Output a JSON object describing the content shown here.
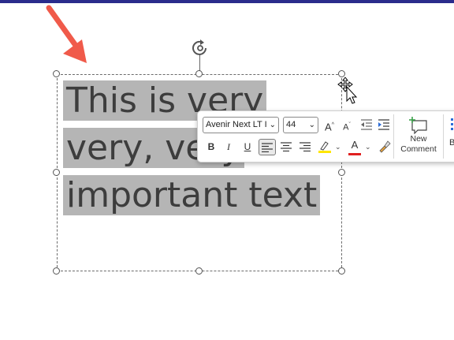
{
  "slide": {
    "text_lines": [
      "This is very",
      "very, very",
      "important text"
    ]
  },
  "mini_toolbar": {
    "font_name": "Avenir Next LT I",
    "font_size": "44",
    "grow_font": "A",
    "shrink_font": "A",
    "bold": "B",
    "italic": "I",
    "underline": "U",
    "font_color": "A",
    "new_comment_line1": "New",
    "new_comment_line2": "Comment",
    "more_label": "B"
  },
  "colors": {
    "top_bar": "#2b2c8c",
    "highlight": "#b5b5b5",
    "arrow": "#f05a4a",
    "highlighter_yellow": "#ffe600",
    "font_color_red": "#e02020",
    "comment_green": "#3aa14a"
  }
}
